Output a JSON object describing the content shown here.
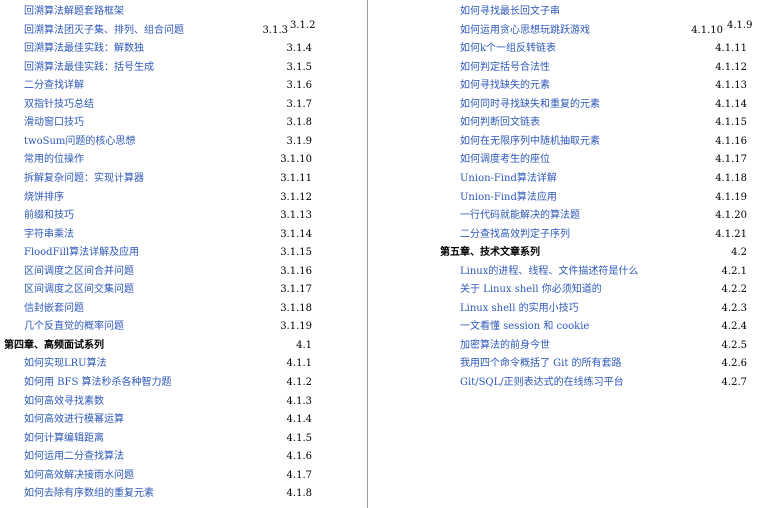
{
  "left": [
    {
      "title": "回溯算法解题套路框架",
      "num": ""
    },
    {
      "title": "回溯算法团灭子集、排列、组合问题",
      "num": "3.1.3",
      "num2": "3.1.2"
    },
    {
      "title": "回溯算法最佳实践：解数独",
      "num": "3.1.4"
    },
    {
      "title": "回溯算法最佳实践：括号生成",
      "num": "3.1.5"
    },
    {
      "title": "二分查找详解",
      "num": "3.1.6"
    },
    {
      "title": "双指针技巧总结",
      "num": "3.1.7"
    },
    {
      "title": "滑动窗口技巧",
      "num": "3.1.8"
    },
    {
      "title": "twoSum问题的核心思想",
      "num": "3.1.9"
    },
    {
      "title": "常用的位操作",
      "num": "3.1.10"
    },
    {
      "title": "拆解复杂问题：实现计算器",
      "num": "3.1.11"
    },
    {
      "title": "烧饼排序",
      "num": "3.1.12"
    },
    {
      "title": "前缀和技巧",
      "num": "3.1.13"
    },
    {
      "title": "字符串乘法",
      "num": "3.1.14"
    },
    {
      "title": "FloodFill算法详解及应用",
      "num": "3.1.15"
    },
    {
      "title": "区间调度之区间合并问题",
      "num": "3.1.16"
    },
    {
      "title": "区间调度之区间交集问题",
      "num": "3.1.17"
    },
    {
      "title": "信封嵌套问题",
      "num": "3.1.18"
    },
    {
      "title": "几个反直觉的概率问题",
      "num": "3.1.19"
    },
    {
      "title": "第四章、高频面试系列",
      "num": "4.1",
      "chapter": true
    },
    {
      "title": "如何实现LRU算法",
      "num": "4.1.1"
    },
    {
      "title": "如何用 BFS 算法秒杀各种智力题",
      "num": "4.1.2"
    },
    {
      "title": "如何高效寻找素数",
      "num": "4.1.3"
    },
    {
      "title": "如何高效进行模幂运算",
      "num": "4.1.4"
    },
    {
      "title": "如何计算编辑距离",
      "num": "4.1.5"
    },
    {
      "title": "如何运用二分查找算法",
      "num": "4.1.6"
    },
    {
      "title": "如何高效解决接雨水问题",
      "num": "4.1.7"
    },
    {
      "title": "如何去除有序数组的重复元素",
      "num": "4.1.8"
    }
  ],
  "right": [
    {
      "title": "如何寻找最长回文子串",
      "num": ""
    },
    {
      "title": "如何运用贪心思想玩跳跃游戏",
      "num": "4.1.10",
      "num2": "4.1.9"
    },
    {
      "title": "如何k个一组反转链表",
      "num": "4.1.11"
    },
    {
      "title": "如何判定括号合法性",
      "num": "4.1.12"
    },
    {
      "title": "如何寻找缺失的元素",
      "num": "4.1.13"
    },
    {
      "title": "如何同时寻找缺失和重复的元素",
      "num": "4.1.14"
    },
    {
      "title": "如何判断回文链表",
      "num": "4.1.15"
    },
    {
      "title": "如何在无限序列中随机抽取元素",
      "num": "4.1.16"
    },
    {
      "title": "如何调度考生的座位",
      "num": "4.1.17"
    },
    {
      "title": "Union-Find算法详解",
      "num": "4.1.18"
    },
    {
      "title": "Union-Find算法应用",
      "num": "4.1.19"
    },
    {
      "title": "一行代码就能解决的算法题",
      "num": "4.1.20"
    },
    {
      "title": "二分查找高效判定子序列",
      "num": "4.1.21"
    },
    {
      "title": "第五章、技术文章系列",
      "num": "4.2",
      "chapter": true
    },
    {
      "title": "Linux的进程、线程、文件描述符是什么",
      "num": "4.2.1"
    },
    {
      "title": "关于 Linux shell 你必须知道的",
      "num": "4.2.2"
    },
    {
      "title": "Linux shell 的实用小技巧",
      "num": "4.2.3"
    },
    {
      "title": "一文看懂 session 和 cookie",
      "num": "4.2.4"
    },
    {
      "title": "加密算法的前身今世",
      "num": "4.2.5"
    },
    {
      "title": "我用四个命令概括了 Git 的所有套路",
      "num": "4.2.6"
    },
    {
      "title": "Git/SQL/正则表达式的在线练习平台",
      "num": "4.2.7"
    }
  ]
}
